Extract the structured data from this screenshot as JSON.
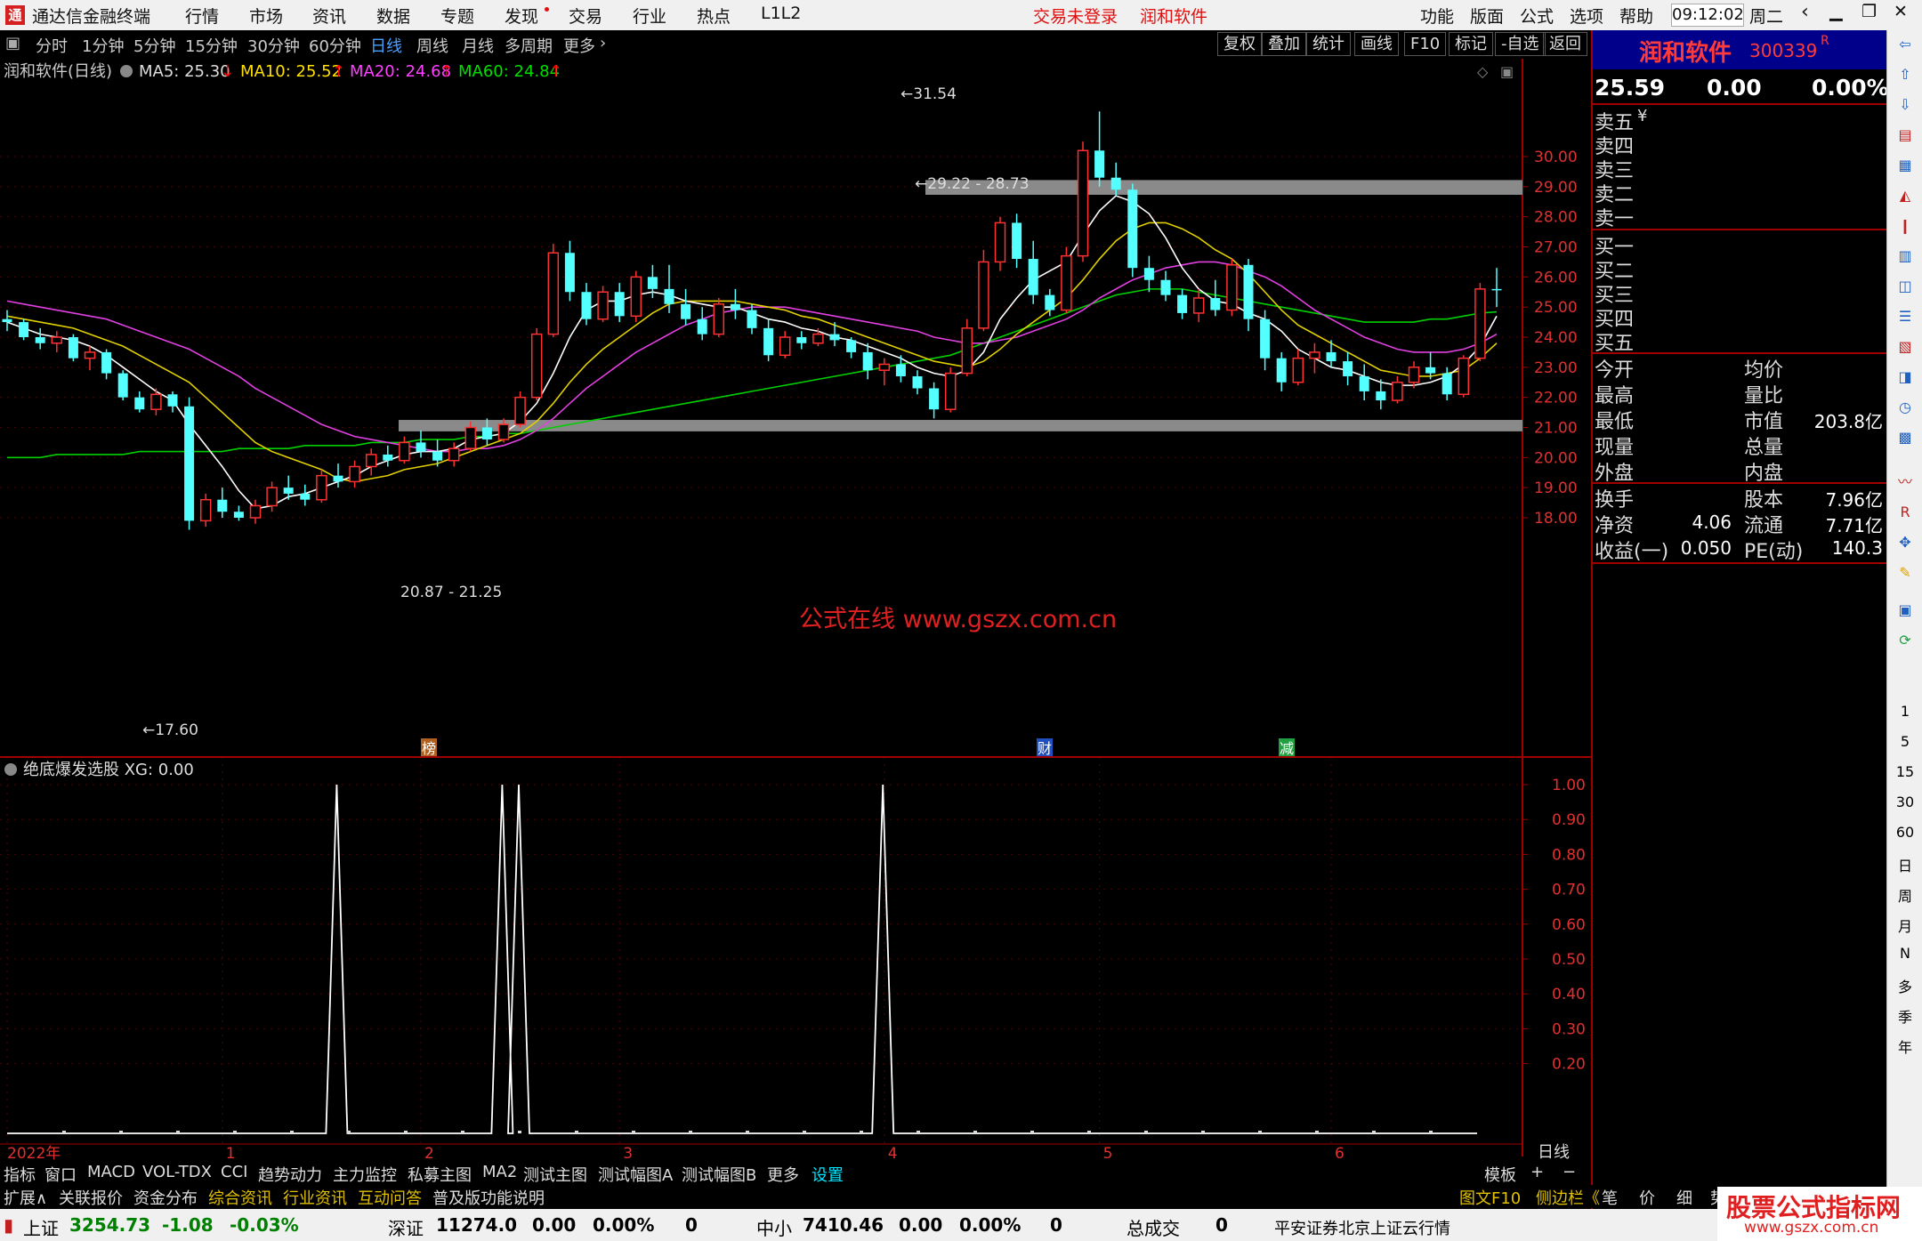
{
  "app": {
    "title": "通达信金融终端",
    "menu": [
      "行情",
      "市场",
      "资讯",
      "数据",
      "专题",
      "发现",
      "交易",
      "行业",
      "热点",
      "L1L2"
    ],
    "login_status": "交易未登录",
    "stock_tag": "润和软件",
    "right_menu": [
      "功能",
      "版面",
      "公式",
      "选项",
      "帮助"
    ],
    "time": "09:12:02",
    "weekday": "周二"
  },
  "period_tabs": [
    "分时",
    "1分钟",
    "5分钟",
    "15分钟",
    "30分钟",
    "60分钟",
    "日线",
    "周线",
    "月线",
    "多周期",
    "更多"
  ],
  "active_period": "日线",
  "chart_tools": [
    "复权",
    "叠加",
    "统计",
    "画线",
    "F10",
    "标记",
    "-自选",
    "返回"
  ],
  "main_legend": {
    "title": "润和软件(日线)",
    "ma5": "MA5: 25.30",
    "ma10": "MA10: 25.52",
    "ma20": "MA20: 24.68",
    "ma60": "MA60: 24.84"
  },
  "annotations": {
    "high": "31.54",
    "low": "17.60",
    "upper_band": "29.22 - 28.73",
    "lower_band": "20.87 - 21.25",
    "watermark": "公式在线  www.gszx.com.cn",
    "event_1": "榜",
    "event_2": "财",
    "event_3": "减"
  },
  "indicator_legend": "绝底爆发选股  XG: 0.00",
  "price_axis": [
    "30.00",
    "29.00",
    "28.00",
    "27.00",
    "26.00",
    "25.00",
    "24.00",
    "23.00",
    "22.00",
    "21.00",
    "20.00",
    "19.00",
    "18.00"
  ],
  "ind_axis": [
    "1.00",
    "0.90",
    "0.80",
    "0.70",
    "0.60",
    "0.50",
    "0.40",
    "0.30",
    "0.20"
  ],
  "time_axis": [
    "2022年",
    "1",
    "2",
    "3",
    "4",
    "5",
    "6"
  ],
  "period_label": "日线",
  "quote": {
    "name": "润和软件",
    "code": "300339",
    "r_mark": "R",
    "price": "25.59",
    "change": "0.00",
    "pct": "0.00%",
    "ask_levels": [
      "卖五",
      "卖四",
      "卖三",
      "卖二",
      "卖一"
    ],
    "ask_mark": "¥",
    "bid_levels": [
      "买一",
      "买二",
      "买三",
      "买四",
      "买五"
    ],
    "stats_left": [
      "今开",
      "最高",
      "最低",
      "现量",
      "外盘"
    ],
    "stats_right": [
      "均价",
      "量比",
      "市值",
      "总量",
      "内盘"
    ],
    "market_cap": "203.8亿",
    "fin": [
      {
        "l": "换手",
        "lv": "",
        "r": "股本",
        "rv": "7.96亿"
      },
      {
        "l": "净资",
        "lv": "4.06",
        "r": "流通",
        "rv": "7.71亿"
      },
      {
        "l": "收益(一)",
        "lv": "0.050",
        "r": "PE(动)",
        "rv": "140.3"
      }
    ]
  },
  "indicator_tabs": [
    "指标",
    "窗口",
    "MACD",
    "VOL-TDX",
    "CCI",
    "趋势动力",
    "主力监控",
    "私募主图",
    "MA2",
    "测试主图",
    "测试幅图A",
    "测试幅图B",
    "更多",
    "设置"
  ],
  "template_btns": [
    "模板",
    "+",
    "−"
  ],
  "func_tabs": [
    "扩展∧",
    "关联报价",
    "资金分布",
    "综合资讯",
    "行业资讯",
    "互动问答",
    "普及版功能说明"
  ],
  "side_tabs": [
    "图文F10",
    "侧边栏《",
    "笔",
    "价",
    "细",
    "势"
  ],
  "right_toolbar_text": [
    "1",
    "5",
    "15",
    "30",
    "60",
    "日",
    "周",
    "月",
    "N",
    "多",
    "季",
    "年"
  ],
  "status": {
    "sh_name": "上证",
    "sh_val": "3254.73",
    "sh_chg": "-1.08",
    "sh_pct": "-0.03%",
    "sz_name": "深证",
    "sz_val": "11274.0",
    "sz_chg": "0.00",
    "sz_pct": "0.00%",
    "sz_vol": "0",
    "zx_name": "中小",
    "zx_val": "7410.46",
    "zx_chg": "0.00",
    "zx_pct": "0.00%",
    "zx_vol": "0",
    "total_lbl": "总成交",
    "total_val": "0",
    "server": "平安证券北京上证云行情"
  },
  "brand": {
    "main": "股票公式指标网",
    "url": "www.gszx.com.cn"
  },
  "chart_data": {
    "type": "candlestick",
    "ylim": [
      17.2,
      31.8
    ],
    "count": 91,
    "ohlc": [
      [
        24.6,
        24.9,
        24.2,
        24.5
      ],
      [
        24.5,
        24.6,
        23.9,
        24.0
      ],
      [
        24.0,
        24.3,
        23.6,
        23.8
      ],
      [
        23.8,
        24.2,
        23.5,
        24.0
      ],
      [
        24.0,
        24.1,
        23.2,
        23.3
      ],
      [
        23.3,
        23.7,
        22.9,
        23.5
      ],
      [
        23.5,
        23.6,
        22.6,
        22.8
      ],
      [
        22.8,
        22.9,
        21.9,
        22.0
      ],
      [
        22.0,
        22.2,
        21.5,
        21.6
      ],
      [
        21.6,
        22.3,
        21.4,
        22.1
      ],
      [
        22.1,
        22.2,
        21.5,
        21.7
      ],
      [
        21.7,
        22.0,
        17.6,
        17.9
      ],
      [
        17.9,
        18.8,
        17.7,
        18.6
      ],
      [
        18.6,
        19.0,
        18.0,
        18.2
      ],
      [
        18.2,
        18.4,
        17.9,
        18.0
      ],
      [
        18.0,
        18.6,
        17.8,
        18.4
      ],
      [
        18.4,
        19.2,
        18.2,
        19.0
      ],
      [
        19.0,
        19.4,
        18.6,
        18.8
      ],
      [
        18.8,
        19.1,
        18.4,
        18.6
      ],
      [
        18.6,
        19.6,
        18.5,
        19.4
      ],
      [
        19.4,
        19.8,
        19.0,
        19.2
      ],
      [
        19.2,
        19.9,
        19.0,
        19.7
      ],
      [
        19.7,
        20.3,
        19.4,
        20.1
      ],
      [
        20.1,
        20.4,
        19.7,
        19.9
      ],
      [
        19.9,
        20.7,
        19.8,
        20.5
      ],
      [
        20.5,
        20.9,
        20.0,
        20.2
      ],
      [
        20.2,
        20.6,
        19.7,
        19.9
      ],
      [
        19.9,
        20.5,
        19.7,
        20.3
      ],
      [
        20.3,
        21.2,
        20.2,
        21.0
      ],
      [
        21.0,
        21.3,
        20.4,
        20.6
      ],
      [
        20.6,
        21.3,
        20.5,
        21.1
      ],
      [
        21.1,
        22.2,
        21.0,
        22.0
      ],
      [
        22.0,
        24.3,
        21.9,
        24.1
      ],
      [
        24.1,
        27.1,
        24.0,
        26.8
      ],
      [
        26.8,
        27.2,
        25.2,
        25.5
      ],
      [
        25.5,
        25.8,
        24.4,
        24.6
      ],
      [
        24.6,
        25.7,
        24.5,
        25.5
      ],
      [
        25.5,
        25.8,
        24.5,
        24.7
      ],
      [
        24.7,
        26.2,
        24.5,
        26.0
      ],
      [
        26.0,
        26.4,
        25.3,
        25.6
      ],
      [
        25.6,
        26.4,
        24.8,
        25.1
      ],
      [
        25.1,
        25.6,
        24.4,
        24.6
      ],
      [
        24.6,
        25.0,
        23.9,
        24.1
      ],
      [
        24.1,
        25.3,
        24.0,
        25.1
      ],
      [
        25.1,
        25.6,
        24.6,
        24.9
      ],
      [
        24.9,
        25.1,
        24.1,
        24.3
      ],
      [
        24.3,
        24.6,
        23.2,
        23.4
      ],
      [
        23.4,
        24.2,
        23.3,
        24.0
      ],
      [
        24.0,
        24.2,
        23.6,
        23.8
      ],
      [
        23.8,
        24.3,
        23.7,
        24.1
      ],
      [
        24.1,
        24.5,
        23.7,
        23.9
      ],
      [
        23.9,
        24.0,
        23.3,
        23.5
      ],
      [
        23.5,
        23.8,
        22.6,
        22.9
      ],
      [
        22.9,
        23.3,
        22.4,
        23.1
      ],
      [
        23.1,
        23.4,
        22.5,
        22.7
      ],
      [
        22.7,
        22.9,
        22.1,
        22.3
      ],
      [
        22.3,
        22.5,
        21.3,
        21.6
      ],
      [
        21.6,
        23.0,
        21.5,
        22.8
      ],
      [
        22.8,
        24.6,
        22.7,
        24.3
      ],
      [
        24.3,
        26.9,
        24.2,
        26.5
      ],
      [
        26.5,
        28.0,
        26.2,
        27.8
      ],
      [
        27.8,
        28.1,
        26.3,
        26.6
      ],
      [
        26.6,
        27.2,
        25.1,
        25.4
      ],
      [
        25.4,
        25.6,
        24.7,
        24.9
      ],
      [
        24.9,
        27.0,
        24.8,
        26.7
      ],
      [
        26.7,
        30.5,
        26.5,
        30.2
      ],
      [
        30.2,
        31.5,
        29.0,
        29.3
      ],
      [
        29.3,
        29.8,
        28.7,
        28.9
      ],
      [
        28.9,
        29.1,
        26.0,
        26.3
      ],
      [
        26.3,
        26.7,
        25.5,
        25.9
      ],
      [
        25.9,
        26.2,
        25.2,
        25.4
      ],
      [
        25.4,
        25.6,
        24.6,
        24.8
      ],
      [
        24.8,
        25.6,
        24.5,
        25.3
      ],
      [
        25.3,
        25.9,
        24.7,
        24.9
      ],
      [
        24.9,
        26.6,
        24.7,
        26.4
      ],
      [
        26.4,
        26.6,
        24.2,
        24.6
      ],
      [
        24.6,
        24.9,
        22.9,
        23.3
      ],
      [
        23.3,
        23.5,
        22.2,
        22.5
      ],
      [
        22.5,
        23.6,
        22.4,
        23.3
      ],
      [
        23.3,
        23.8,
        22.8,
        23.5
      ],
      [
        23.5,
        23.9,
        23.0,
        23.2
      ],
      [
        23.2,
        23.5,
        22.4,
        22.7
      ],
      [
        22.7,
        23.1,
        21.9,
        22.2
      ],
      [
        22.2,
        22.6,
        21.6,
        21.9
      ],
      [
        21.9,
        22.7,
        21.8,
        22.5
      ],
      [
        22.5,
        23.2,
        22.3,
        23.0
      ],
      [
        23.0,
        23.5,
        22.6,
        22.8
      ],
      [
        22.8,
        23.0,
        21.9,
        22.1
      ],
      [
        22.1,
        23.4,
        22.0,
        23.3
      ],
      [
        23.3,
        25.8,
        23.2,
        25.6
      ],
      [
        25.6,
        26.3,
        25.0,
        25.59
      ]
    ],
    "ma5": [
      24.5,
      24.3,
      24.1,
      24.0,
      23.9,
      23.7,
      23.4,
      23.0,
      22.6,
      22.2,
      21.9,
      21.1,
      20.4,
      19.7,
      18.9,
      18.3,
      18.4,
      18.7,
      18.8,
      19.0,
      19.2,
      19.4,
      19.7,
      19.9,
      20.1,
      20.2,
      20.2,
      20.3,
      20.6,
      20.7,
      20.8,
      21.2,
      21.8,
      22.8,
      24.0,
      24.9,
      25.2,
      25.2,
      25.4,
      25.5,
      25.4,
      25.2,
      25.1,
      25.0,
      25.0,
      24.8,
      24.6,
      24.5,
      24.3,
      24.2,
      24.0,
      23.9,
      23.7,
      23.5,
      23.3,
      23.0,
      22.8,
      22.7,
      22.9,
      23.5,
      24.6,
      25.3,
      25.9,
      26.2,
      26.5,
      27.4,
      28.2,
      28.7,
      28.5,
      28.1,
      27.3,
      26.3,
      25.6,
      25.2,
      25.1,
      24.8,
      24.6,
      24.2,
      23.6,
      23.3,
      23.0,
      22.9,
      22.7,
      22.5,
      22.4,
      22.4,
      22.5,
      22.7,
      23.1,
      23.7,
      24.7
    ],
    "ma10": [
      24.7,
      24.6,
      24.5,
      24.4,
      24.3,
      24.1,
      23.9,
      23.7,
      23.4,
      23.1,
      22.8,
      22.5,
      22.0,
      21.5,
      21.0,
      20.5,
      20.2,
      20.0,
      19.8,
      19.6,
      19.3,
      19.2,
      19.3,
      19.4,
      19.6,
      19.7,
      19.8,
      20.0,
      20.2,
      20.4,
      20.6,
      20.8,
      21.2,
      21.8,
      22.5,
      23.1,
      23.6,
      24.0,
      24.4,
      24.8,
      25.1,
      25.2,
      25.2,
      25.2,
      25.2,
      25.1,
      25.0,
      24.9,
      24.7,
      24.6,
      24.4,
      24.2,
      24.0,
      23.8,
      23.6,
      23.4,
      23.2,
      23.1,
      23.0,
      23.2,
      23.6,
      24.1,
      24.5,
      24.9,
      25.3,
      25.9,
      26.6,
      27.2,
      27.6,
      27.8,
      27.8,
      27.6,
      27.3,
      26.9,
      26.6,
      26.1,
      25.5,
      24.9,
      24.4,
      24.1,
      23.8,
      23.5,
      23.2,
      22.9,
      22.8,
      22.7,
      22.7,
      22.8,
      22.9,
      23.3,
      23.8
    ],
    "ma20": [
      25.2,
      25.1,
      25.0,
      24.9,
      24.8,
      24.7,
      24.6,
      24.4,
      24.2,
      24.0,
      23.8,
      23.6,
      23.3,
      23.0,
      22.7,
      22.3,
      22.0,
      21.7,
      21.4,
      21.1,
      20.9,
      20.7,
      20.6,
      20.5,
      20.4,
      20.3,
      20.2,
      20.2,
      20.3,
      20.3,
      20.4,
      20.6,
      20.9,
      21.3,
      21.8,
      22.3,
      22.7,
      23.1,
      23.5,
      23.8,
      24.1,
      24.4,
      24.6,
      24.8,
      24.9,
      25.0,
      25.0,
      25.0,
      24.9,
      24.8,
      24.7,
      24.6,
      24.5,
      24.4,
      24.3,
      24.2,
      24.0,
      23.9,
      23.8,
      23.8,
      23.9,
      24.0,
      24.2,
      24.4,
      24.6,
      24.9,
      25.3,
      25.6,
      25.9,
      26.1,
      26.3,
      26.4,
      26.5,
      26.5,
      26.4,
      26.2,
      26.0,
      25.7,
      25.3,
      24.9,
      24.6,
      24.3,
      24.0,
      23.8,
      23.6,
      23.5,
      23.5,
      23.5,
      23.6,
      23.8,
      24.1
    ],
    "ma60": [
      20.0,
      20.0,
      20.0,
      20.1,
      20.1,
      20.1,
      20.1,
      20.1,
      20.2,
      20.2,
      20.2,
      20.2,
      20.2,
      20.2,
      20.3,
      20.3,
      20.3,
      20.3,
      20.4,
      20.4,
      20.4,
      20.4,
      20.5,
      20.5,
      20.5,
      20.6,
      20.6,
      20.6,
      20.7,
      20.7,
      20.8,
      20.8,
      20.9,
      21.0,
      21.1,
      21.2,
      21.3,
      21.4,
      21.5,
      21.6,
      21.7,
      21.8,
      21.9,
      22.0,
      22.1,
      22.2,
      22.3,
      22.4,
      22.5,
      22.6,
      22.7,
      22.8,
      22.9,
      23.0,
      23.1,
      23.2,
      23.3,
      23.4,
      23.6,
      23.8,
      24.0,
      24.2,
      24.4,
      24.6,
      24.8,
      25.0,
      25.2,
      25.4,
      25.5,
      25.6,
      25.6,
      25.6,
      25.5,
      25.4,
      25.3,
      25.2,
      25.1,
      25.0,
      24.9,
      24.8,
      24.7,
      24.6,
      24.5,
      24.5,
      24.5,
      24.5,
      24.6,
      24.6,
      24.7,
      24.8,
      24.84
    ],
    "xg_signal_index": [
      14,
      24,
      25,
      47
    ]
  }
}
